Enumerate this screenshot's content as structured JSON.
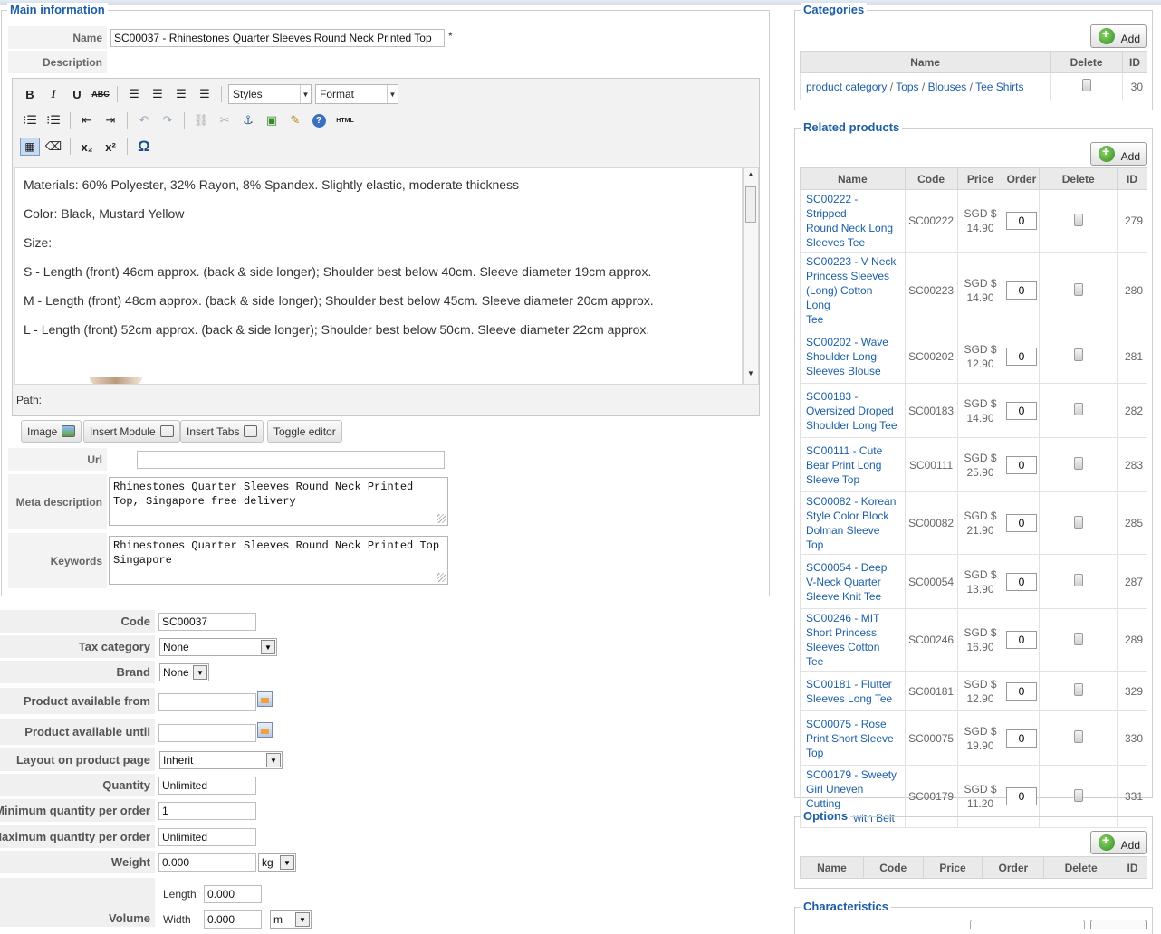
{
  "main_info": {
    "legend": "Main information",
    "name_label": "Name",
    "name_value": "SC00037 - Rhinestones Quarter Sleeves Round Neck Printed Top",
    "required_mark": "*",
    "description_label": "Description",
    "url_label": "Url",
    "url_value": "",
    "meta_label": "Meta description",
    "meta_value": "Rhinestones Quarter Sleeves Round Neck Printed Top, Singapore free delivery",
    "keywords_label": "Keywords",
    "keywords_value": "Rhinestones Quarter Sleeves Round Neck Printed Top Singapore"
  },
  "editor": {
    "toolbar": {
      "bold": "B",
      "italic": "I",
      "underline": "U",
      "strike": "ABC",
      "styles": "Styles",
      "format": "Format",
      "html": "HTML",
      "omega": "Ω",
      "sub": "x₂",
      "sup": "x²"
    },
    "lines": [
      "Materials: 60% Polyester, 32% Rayon, 8% Spandex. Slightly elastic, moderate thickness",
      "Color: Black, Mustard Yellow",
      "Size:",
      "S - Length (front) 46cm approx. (back & side longer); Shoulder best below 40cm. Sleeve diameter 19cm approx.",
      "M - Length (front) 48cm approx. (back & side longer); Shoulder best below 45cm. Sleeve diameter 20cm approx.",
      "L - Length (front) 52cm approx. (back & side longer); Shoulder best below 50cm. Sleeve diameter 22cm approx."
    ],
    "path_label": "Path:",
    "buttons": {
      "image": "Image",
      "insert_module": "Insert Module",
      "insert_tabs": "Insert Tabs",
      "toggle_editor": "Toggle editor"
    }
  },
  "product": {
    "code_label": "Code",
    "code_value": "SC00037",
    "tax_label": "Tax category",
    "tax_value": "None",
    "brand_label": "Brand",
    "brand_value": "None",
    "available_from_label": "Product available from",
    "available_until_label": "Product available until",
    "layout_label": "Layout on product page",
    "layout_value": "Inherit",
    "quantity_label": "Quantity",
    "quantity_value": "Unlimited",
    "min_label": "Minimum quantity per order",
    "min_value": "1",
    "max_label": "Maximum quantity per order",
    "max_value": "Unlimited",
    "weight_label": "Weight",
    "weight_value": "0.000",
    "weight_unit": "kg",
    "volume_label": "Volume",
    "length_label": "Length",
    "length_value": "0.000",
    "width_label": "Width",
    "width_value": "0.000",
    "volume_unit": "m"
  },
  "categories": {
    "legend": "Categories",
    "add_label": "Add",
    "headers": [
      "Name",
      "Delete",
      "ID"
    ],
    "rows": [
      {
        "path": [
          "product category",
          "Tops",
          "Blouses",
          "Tee Shirts"
        ],
        "separator": "/",
        "id": "30"
      }
    ]
  },
  "related": {
    "legend": "Related products",
    "add_label": "Add",
    "headers": [
      "Name",
      "Code",
      "Price",
      "Order",
      "Delete",
      "ID"
    ],
    "rows": [
      {
        "name": [
          "SC00222 - Stripped",
          "Round Neck Long",
          "Sleeves Tee"
        ],
        "code": "SC00222",
        "currency": "SGD $",
        "price": "14.90",
        "order": "0",
        "id": "279"
      },
      {
        "name": [
          "SC00223 - V Neck",
          "Princess Sleeves",
          "(Long) Cotton Long",
          "Tee"
        ],
        "code": "SC00223",
        "currency": "SGD $",
        "price": "14.90",
        "order": "0",
        "id": "280"
      },
      {
        "name": [
          "SC00202 - Wave",
          "Shoulder Long",
          "Sleeves Blouse"
        ],
        "code": "SC00202",
        "currency": "SGD $",
        "price": "12.90",
        "order": "0",
        "id": "281"
      },
      {
        "name": [
          "SC00183 -",
          "Oversized Droped",
          "Shoulder Long Tee"
        ],
        "code": "SC00183",
        "currency": "SGD $",
        "price": "14.90",
        "order": "0",
        "id": "282"
      },
      {
        "name": [
          "SC00111 - Cute",
          "Bear Print Long",
          "Sleeve Top"
        ],
        "code": "SC00111",
        "currency": "SGD $",
        "price": "25.90",
        "order": "0",
        "id": "283"
      },
      {
        "name": [
          "SC00082 - Korean",
          "Style Color Block",
          "Dolman Sleeve Top"
        ],
        "code": "SC00082",
        "currency": "SGD $",
        "price": "21.90",
        "order": "0",
        "id": "285"
      },
      {
        "name": [
          "SC00054 - Deep",
          "V-Neck Quarter",
          "Sleeve Knit Tee"
        ],
        "code": "SC00054",
        "currency": "SGD $",
        "price": "13.90",
        "order": "0",
        "id": "287"
      },
      {
        "name": [
          "SC00246 - MIT",
          "Short Princess",
          "Sleeves Cotton Tee"
        ],
        "code": "SC00246",
        "currency": "SGD $",
        "price": "16.90",
        "order": "0",
        "id": "289"
      },
      {
        "name": [
          "SC00181 - Flutter",
          "Sleeves Long Tee"
        ],
        "code": "SC00181",
        "currency": "SGD $",
        "price": "12.90",
        "order": "0",
        "id": "329"
      },
      {
        "name": [
          "SC00075 - Rose",
          "Print Short Sleeve",
          "Top"
        ],
        "code": "SC00075",
        "currency": "SGD $",
        "price": "19.90",
        "order": "0",
        "id": "330"
      },
      {
        "name": [
          "SC00179 - Sweety",
          "Girl Uneven Cutting",
          "Long Tee with Belt"
        ],
        "code": "SC00179",
        "currency": "SGD $",
        "price": "11.20",
        "order": "0",
        "id": "331"
      }
    ]
  },
  "options": {
    "legend": "Options",
    "add_label": "Add",
    "headers": [
      "Name",
      "Code",
      "Price",
      "Order",
      "Delete",
      "ID"
    ]
  },
  "characteristics": {
    "legend": "Characteristics"
  }
}
